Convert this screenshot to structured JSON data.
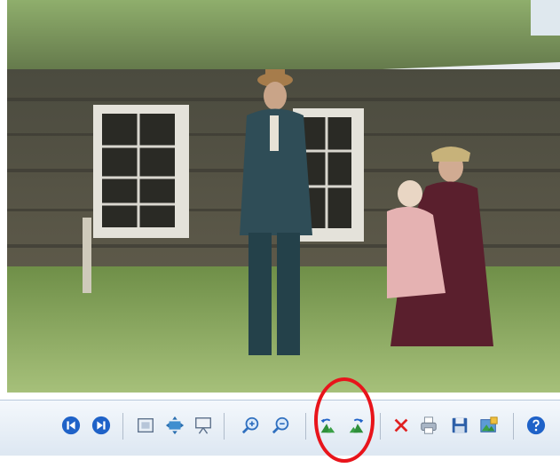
{
  "viewer": {
    "photo_icon": "photo-image",
    "colors": {
      "toolbar_bg": "#e6eef7",
      "annotation": "#e8141b"
    },
    "toolbar": {
      "buttons": [
        {
          "icon": "previous-icon",
          "label": ""
        },
        {
          "icon": "next-icon",
          "label": ""
        },
        {
          "icon": "actual-size-icon",
          "label": ""
        },
        {
          "icon": "fit-to-window-icon",
          "label": ""
        },
        {
          "icon": "slideshow-icon",
          "label": ""
        },
        {
          "icon": "zoom-in-icon",
          "label": ""
        },
        {
          "icon": "zoom-out-icon",
          "label": ""
        },
        {
          "icon": "rotate-counterclockwise-icon",
          "label": ""
        },
        {
          "icon": "rotate-clockwise-icon",
          "label": ""
        },
        {
          "icon": "delete-icon",
          "label": ""
        },
        {
          "icon": "print-icon",
          "label": ""
        },
        {
          "icon": "save-icon",
          "label": ""
        },
        {
          "icon": "open-in-editor-icon",
          "label": ""
        },
        {
          "icon": "help-icon",
          "label": ""
        }
      ]
    },
    "annotation": {
      "shape": "ellipse",
      "color": "#e8141b"
    }
  }
}
